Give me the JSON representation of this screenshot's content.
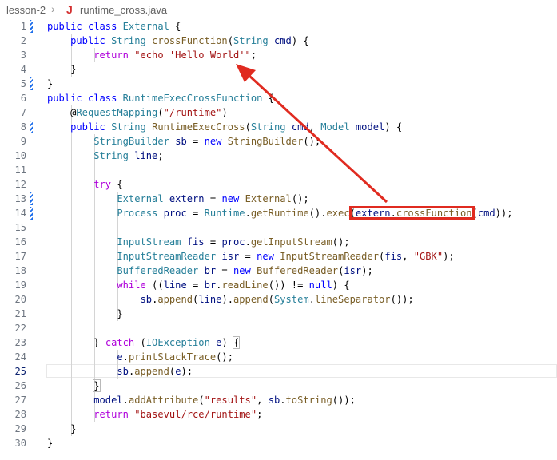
{
  "breadcrumb": {
    "folder": "lesson-2",
    "separator_icon": "chevron-right-icon",
    "file_icon": "java-icon",
    "file_icon_glyph": "J",
    "file": "runtime_cross.java"
  },
  "editor": {
    "active_line": 25,
    "lines": [
      {
        "n": "1",
        "tokens": [
          [
            "kw",
            "public"
          ],
          [
            "pl",
            " "
          ],
          [
            "kw",
            "class"
          ],
          [
            "pl",
            " "
          ],
          [
            "type",
            "External"
          ],
          [
            "pl",
            " {"
          ]
        ]
      },
      {
        "n": "2",
        "tokens": [
          [
            "pl",
            "    "
          ],
          [
            "kw",
            "public"
          ],
          [
            "pl",
            " "
          ],
          [
            "type",
            "String"
          ],
          [
            "pl",
            " "
          ],
          [
            "fn",
            "crossFunction"
          ],
          [
            "pl",
            "("
          ],
          [
            "type",
            "String"
          ],
          [
            "pl",
            " "
          ],
          [
            "var",
            "cmd"
          ],
          [
            "pl",
            ") {"
          ]
        ]
      },
      {
        "n": "3",
        "tokens": [
          [
            "pl",
            "        "
          ],
          [
            "ctl",
            "return"
          ],
          [
            "pl",
            " "
          ],
          [
            "str",
            "\"echo 'Hello World'\""
          ],
          [
            "pl",
            ";"
          ]
        ]
      },
      {
        "n": "4",
        "tokens": [
          [
            "pl",
            "    }"
          ]
        ]
      },
      {
        "n": "5",
        "tokens": [
          [
            "pl",
            "}"
          ]
        ]
      },
      {
        "n": "6",
        "tokens": [
          [
            "kw",
            "public"
          ],
          [
            "pl",
            " "
          ],
          [
            "kw",
            "class"
          ],
          [
            "pl",
            " "
          ],
          [
            "type",
            "RuntimeExecCrossFunction"
          ],
          [
            "pl",
            " {"
          ]
        ]
      },
      {
        "n": "7",
        "tokens": [
          [
            "pl",
            "    "
          ],
          [
            "ann",
            "@"
          ],
          [
            "type",
            "RequestMapping"
          ],
          [
            "pl",
            "("
          ],
          [
            "str",
            "\"/runtime\""
          ],
          [
            "pl",
            ")"
          ]
        ]
      },
      {
        "n": "8",
        "tokens": [
          [
            "pl",
            "    "
          ],
          [
            "kw",
            "public"
          ],
          [
            "pl",
            " "
          ],
          [
            "type",
            "String"
          ],
          [
            "pl",
            " "
          ],
          [
            "fn",
            "RuntimeExecCross"
          ],
          [
            "pl",
            "("
          ],
          [
            "type",
            "String"
          ],
          [
            "pl",
            " "
          ],
          [
            "var",
            "cmd"
          ],
          [
            "pl",
            ", "
          ],
          [
            "type",
            "Model"
          ],
          [
            "pl",
            " "
          ],
          [
            "var",
            "model"
          ],
          [
            "pl",
            ") {"
          ]
        ]
      },
      {
        "n": "9",
        "tokens": [
          [
            "pl",
            "        "
          ],
          [
            "type",
            "StringBuilder"
          ],
          [
            "pl",
            " "
          ],
          [
            "var",
            "sb"
          ],
          [
            "pl",
            " = "
          ],
          [
            "kw",
            "new"
          ],
          [
            "pl",
            " "
          ],
          [
            "fn",
            "StringBuilder"
          ],
          [
            "pl",
            "();"
          ]
        ]
      },
      {
        "n": "10",
        "tokens": [
          [
            "pl",
            "        "
          ],
          [
            "type",
            "String"
          ],
          [
            "pl",
            " "
          ],
          [
            "var",
            "line"
          ],
          [
            "pl",
            ";"
          ]
        ]
      },
      {
        "n": "11",
        "tokens": []
      },
      {
        "n": "12",
        "tokens": [
          [
            "pl",
            "        "
          ],
          [
            "ctl",
            "try"
          ],
          [
            "pl",
            " {"
          ]
        ]
      },
      {
        "n": "13",
        "tokens": [
          [
            "pl",
            "            "
          ],
          [
            "type",
            "External"
          ],
          [
            "pl",
            " "
          ],
          [
            "var",
            "extern"
          ],
          [
            "pl",
            " = "
          ],
          [
            "kw",
            "new"
          ],
          [
            "pl",
            " "
          ],
          [
            "fn",
            "External"
          ],
          [
            "pl",
            "();"
          ]
        ]
      },
      {
        "n": "14",
        "tokens": [
          [
            "pl",
            "            "
          ],
          [
            "type",
            "Process"
          ],
          [
            "pl",
            " "
          ],
          [
            "var",
            "proc"
          ],
          [
            "pl",
            " = "
          ],
          [
            "type",
            "Runtime"
          ],
          [
            "pl",
            "."
          ],
          [
            "fn",
            "getRuntime"
          ],
          [
            "pl",
            "()."
          ],
          [
            "fn",
            "exec"
          ],
          [
            "pl",
            "("
          ],
          [
            "var",
            "extern"
          ],
          [
            "pl",
            "."
          ],
          [
            "fn",
            "crossFunction"
          ],
          [
            "pl",
            "("
          ],
          [
            "var",
            "cmd"
          ],
          [
            "pl",
            "));"
          ]
        ]
      },
      {
        "n": "15",
        "tokens": []
      },
      {
        "n": "16",
        "tokens": [
          [
            "pl",
            "            "
          ],
          [
            "type",
            "InputStream"
          ],
          [
            "pl",
            " "
          ],
          [
            "var",
            "fis"
          ],
          [
            "pl",
            " = "
          ],
          [
            "var",
            "proc"
          ],
          [
            "pl",
            "."
          ],
          [
            "fn",
            "getInputStream"
          ],
          [
            "pl",
            "();"
          ]
        ]
      },
      {
        "n": "17",
        "tokens": [
          [
            "pl",
            "            "
          ],
          [
            "type",
            "InputStreamReader"
          ],
          [
            "pl",
            " "
          ],
          [
            "var",
            "isr"
          ],
          [
            "pl",
            " = "
          ],
          [
            "kw",
            "new"
          ],
          [
            "pl",
            " "
          ],
          [
            "fn",
            "InputStreamReader"
          ],
          [
            "pl",
            "("
          ],
          [
            "var",
            "fis"
          ],
          [
            "pl",
            ", "
          ],
          [
            "str",
            "\"GBK\""
          ],
          [
            "pl",
            ");"
          ]
        ]
      },
      {
        "n": "18",
        "tokens": [
          [
            "pl",
            "            "
          ],
          [
            "type",
            "BufferedReader"
          ],
          [
            "pl",
            " "
          ],
          [
            "var",
            "br"
          ],
          [
            "pl",
            " = "
          ],
          [
            "kw",
            "new"
          ],
          [
            "pl",
            " "
          ],
          [
            "fn",
            "BufferedReader"
          ],
          [
            "pl",
            "("
          ],
          [
            "var",
            "isr"
          ],
          [
            "pl",
            ");"
          ]
        ]
      },
      {
        "n": "19",
        "tokens": [
          [
            "pl",
            "            "
          ],
          [
            "ctl",
            "while"
          ],
          [
            "pl",
            " (("
          ],
          [
            "var",
            "line"
          ],
          [
            "pl",
            " = "
          ],
          [
            "var",
            "br"
          ],
          [
            "pl",
            "."
          ],
          [
            "fn",
            "readLine"
          ],
          [
            "pl",
            "()) != "
          ],
          [
            "lit",
            "null"
          ],
          [
            "pl",
            ") {"
          ]
        ]
      },
      {
        "n": "20",
        "tokens": [
          [
            "pl",
            "                "
          ],
          [
            "var",
            "sb"
          ],
          [
            "pl",
            "."
          ],
          [
            "fn",
            "append"
          ],
          [
            "pl",
            "("
          ],
          [
            "var",
            "line"
          ],
          [
            "pl",
            ")."
          ],
          [
            "fn",
            "append"
          ],
          [
            "pl",
            "("
          ],
          [
            "type",
            "System"
          ],
          [
            "pl",
            "."
          ],
          [
            "fn",
            "lineSeparator"
          ],
          [
            "pl",
            "());"
          ]
        ]
      },
      {
        "n": "21",
        "tokens": [
          [
            "pl",
            "            }"
          ]
        ]
      },
      {
        "n": "22",
        "tokens": []
      },
      {
        "n": "23",
        "tokens": [
          [
            "pl",
            "        } "
          ],
          [
            "ctl",
            "catch"
          ],
          [
            "pl",
            " ("
          ],
          [
            "type",
            "IOException"
          ],
          [
            "pl",
            " "
          ],
          [
            "var",
            "e"
          ],
          [
            "pl",
            ") "
          ],
          [
            "pl",
            "{"
          ]
        ]
      },
      {
        "n": "24",
        "tokens": [
          [
            "pl",
            "            "
          ],
          [
            "var",
            "e"
          ],
          [
            "pl",
            "."
          ],
          [
            "fn",
            "printStackTrace"
          ],
          [
            "pl",
            "();"
          ]
        ]
      },
      {
        "n": "25",
        "tokens": [
          [
            "pl",
            "            "
          ],
          [
            "var",
            "sb"
          ],
          [
            "pl",
            "."
          ],
          [
            "fn",
            "append"
          ],
          [
            "pl",
            "("
          ],
          [
            "var",
            "e"
          ],
          [
            "pl",
            ");"
          ]
        ]
      },
      {
        "n": "26",
        "tokens": [
          [
            "pl",
            "        }"
          ]
        ]
      },
      {
        "n": "27",
        "tokens": [
          [
            "pl",
            "        "
          ],
          [
            "var",
            "model"
          ],
          [
            "pl",
            "."
          ],
          [
            "fn",
            "addAttribute"
          ],
          [
            "pl",
            "("
          ],
          [
            "str",
            "\"results\""
          ],
          [
            "pl",
            ", "
          ],
          [
            "var",
            "sb"
          ],
          [
            "pl",
            "."
          ],
          [
            "fn",
            "toString"
          ],
          [
            "pl",
            "());"
          ]
        ]
      },
      {
        "n": "28",
        "tokens": [
          [
            "pl",
            "        "
          ],
          [
            "ctl",
            "return"
          ],
          [
            "pl",
            " "
          ],
          [
            "str",
            "\"basevul/rce/runtime\""
          ],
          [
            "pl",
            ";"
          ]
        ]
      },
      {
        "n": "29",
        "tokens": [
          [
            "pl",
            "    }"
          ]
        ]
      },
      {
        "n": "30",
        "tokens": [
          [
            "pl",
            "}"
          ]
        ]
      }
    ],
    "modified_lines": [
      "1",
      "5",
      "8",
      "13",
      "14"
    ]
  },
  "annotation": {
    "highlight_color": "#e02b20",
    "highlight_icon": "red-highlight-box",
    "arrow_icon": "red-arrow-icon"
  }
}
